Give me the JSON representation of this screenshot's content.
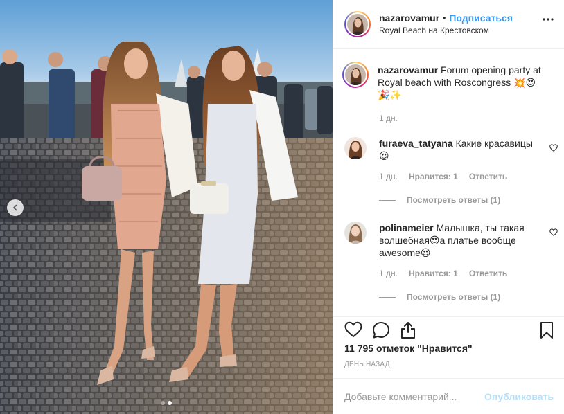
{
  "post": {
    "author": {
      "username": "nazarovamur",
      "follow_label": "Подписаться",
      "separator": "•",
      "location": "Royal Beach на Крестовском"
    },
    "caption": {
      "username": "nazarovamur",
      "text": "Forum opening party at Royal beach with Roscongress 💥😍🎉✨",
      "time": "1 дн."
    },
    "comments": [
      {
        "username": "furaeva_tatyana",
        "text": "Какие красавицы😍",
        "time": "1 дн.",
        "likes": "Нравится: 1",
        "reply_label": "Ответить",
        "view_replies": "Посмотреть ответы (1)"
      },
      {
        "username": "polinameier",
        "text": "Малышка, ты такая волшебная😍а платье вообще awesome😍",
        "time": "1 дн.",
        "likes": "Нравится: 1",
        "reply_label": "Ответить",
        "view_replies": "Посмотреть ответы (1)"
      }
    ],
    "likes_text": "11 795 отметок \"Нравится\"",
    "time_ago": "ДЕНЬ НАЗАД",
    "add_comment_placeholder": "Добавьте комментарий...",
    "publish_label": "Опубликовать",
    "carousel": {
      "slide_count": 2,
      "active_index": 1
    },
    "icons": {
      "more": "more-options-icon",
      "like": "heart-icon",
      "comment": "comment-icon",
      "share": "share-icon",
      "save": "bookmark-icon",
      "comment_like": "small-heart-icon",
      "prev": "chevron-left-icon"
    },
    "colors": {
      "link_blue": "#3897f0",
      "publish_disabled": "#b2dffc",
      "muted": "#999999",
      "text": "#262626",
      "border": "#efefef"
    }
  }
}
